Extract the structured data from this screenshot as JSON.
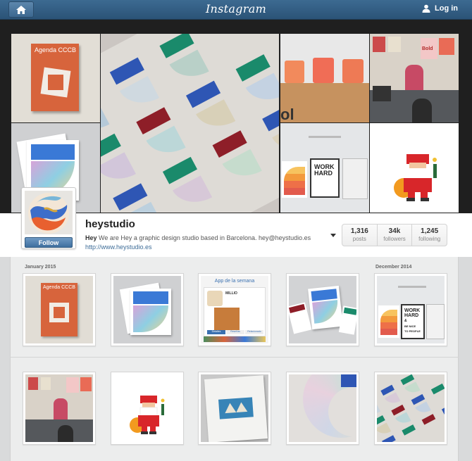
{
  "nav": {
    "logo": "Instagram",
    "login": "Log in"
  },
  "profile": {
    "username": "heystudio",
    "bio_name": "Hey",
    "bio_text": " We are Hey a graphic design studio based in Barcelona. hey@heystudio.es",
    "website": "http://www.heystudio.es",
    "follow_label": "Follow",
    "stats": [
      {
        "value": "1,316",
        "label": "posts"
      },
      {
        "value": "34k",
        "label": "followers"
      },
      {
        "value": "1,245",
        "label": "following"
      }
    ]
  },
  "feed": {
    "month_1": "January 2015",
    "month_2": "December 2014"
  },
  "art": {
    "book_title": "Agenda CCCB",
    "work_hard_1": "WORK",
    "work_hard_2": "HARD",
    "work_hard_3": "&",
    "work_hard_4": "BE NICE",
    "work_hard_5": "TO PEOPLE",
    "hello_bold": "Bold",
    "app_title": "App de la semana",
    "app_name": "MILLIO",
    "app_tab_1": "Detalles",
    "app_tab_2": "Reseñas",
    "app_tab_3": "Relacionado"
  },
  "colors": {
    "nav_blue": "#2f5a80",
    "link_blue": "#3e6d98",
    "book_orange": "#d2683f",
    "print_blue": "#2e56b4",
    "print_green": "#1a8a6b",
    "print_red": "#8e1e28"
  }
}
